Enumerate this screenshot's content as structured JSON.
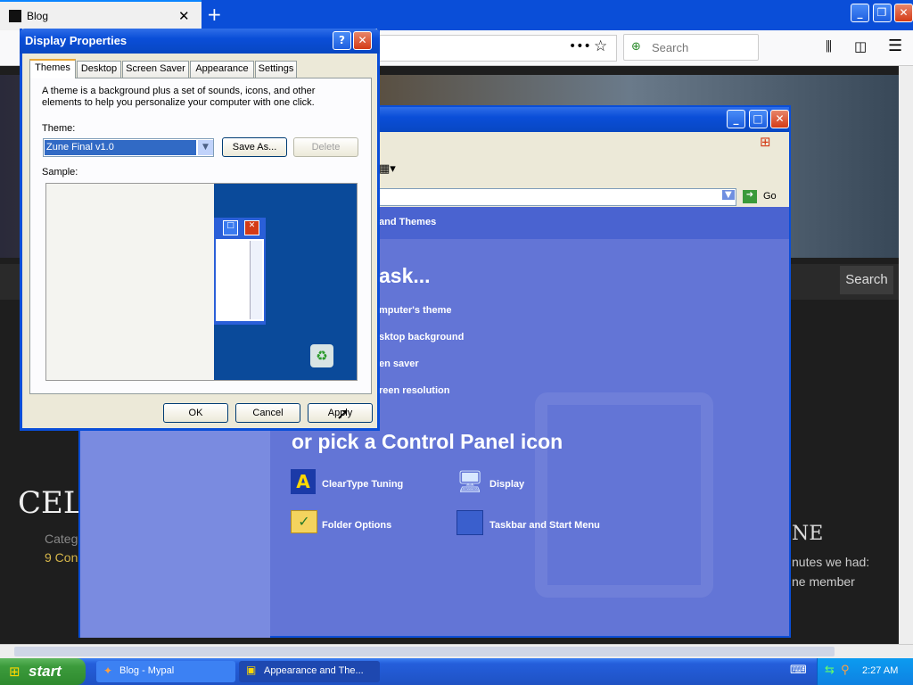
{
  "browser": {
    "tab_title": "Blog",
    "search_placeholder": "Search",
    "site_search_button": "Search",
    "post_title": "CELLO",
    "post_category": "Categ",
    "post_comments": "9 Con",
    "side_heading": "NE",
    "side_text_1": "nutes we had:",
    "side_text_2": "ne member"
  },
  "control_panel": {
    "nav_title": "and Themes",
    "go_label": "Go",
    "task_heading": "ask...",
    "tasks": [
      "mputer's theme",
      "sktop background",
      "en saver",
      "reen resolution"
    ],
    "icon_heading": "or pick a Control Panel icon",
    "icons": [
      "ClearType Tuning",
      "Display",
      "Folder Options",
      "Taskbar and Start Menu"
    ]
  },
  "dialog": {
    "title": "Display Properties",
    "tabs": [
      "Themes",
      "Desktop",
      "Screen Saver",
      "Appearance",
      "Settings"
    ],
    "description": "A theme is a background plus a set of sounds, icons, and other elements to help you personalize your computer with one click.",
    "theme_label": "Theme:",
    "theme_value": "Zune Final v1.0",
    "save_as": "Save As...",
    "delete": "Delete",
    "sample_label": "Sample:",
    "ok": "OK",
    "cancel": "Cancel",
    "apply": "Apply"
  },
  "taskbar": {
    "start": "start",
    "items": [
      "Blog - Mypal",
      "Appearance and The..."
    ],
    "clock": "2:27 AM"
  },
  "colors": {
    "xp_blue": "#245edb",
    "cp_bg": "#6375d6",
    "dialog_bg": "#ece9d8",
    "taskbar": "#245edb",
    "start_green": "#3c9b3c"
  }
}
